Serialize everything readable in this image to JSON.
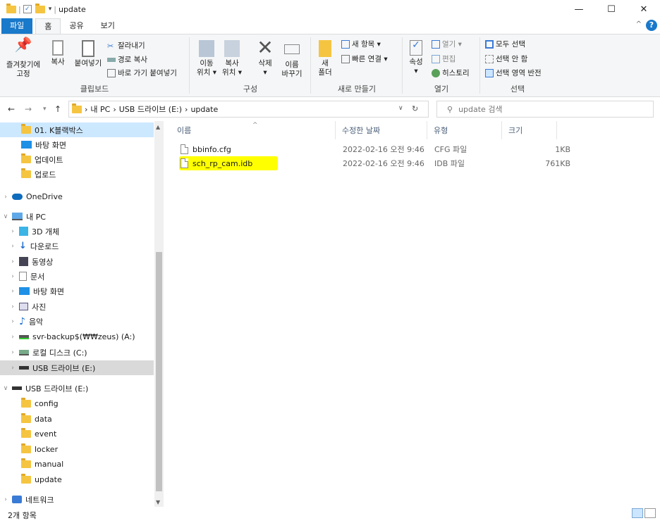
{
  "window": {
    "title": "update",
    "minimize": "—",
    "maximize": "☐",
    "close": "✕"
  },
  "tabs": {
    "file": "파일",
    "home": "홈",
    "share": "공유",
    "view": "보기"
  },
  "ribbon": {
    "clipboard": {
      "label": "클립보드",
      "pin": "즐겨찾기에\n고정",
      "copy": "복사",
      "paste": "붙여넣기",
      "cut": "잘라내기",
      "copy_path": "경로 복사",
      "paste_shortcut": "바로 가기 붙여넣기"
    },
    "organize": {
      "label": "구성",
      "move_to": "이동\n위치 ▾",
      "copy_to": "복사\n위치 ▾",
      "delete": "삭제\n▾",
      "rename": "이름\n바꾸기"
    },
    "new": {
      "label": "새로 만들기",
      "new_folder": "새\n폴더",
      "new_item": "새 항목 ▾",
      "easy_access": "빠른 연결 ▾"
    },
    "open": {
      "label": "열기",
      "properties": "속성\n▾",
      "open": "열기 ▾",
      "edit": "편집",
      "history": "히스토리"
    },
    "select": {
      "label": "선택",
      "select_all": "모두 선택",
      "select_none": "선택 안 함",
      "invert": "선택 영역 반전"
    }
  },
  "address": {
    "crumbs": [
      "내 PC",
      "USB 드라이브 (E:)",
      "update"
    ],
    "search_placeholder": "update 검색"
  },
  "nav": {
    "items": [
      {
        "label": "01. K블랙박스",
        "icon": "folder-icon"
      },
      {
        "label": "바탕 화면",
        "icon": "desktop-icon"
      },
      {
        "label": "업데이트",
        "icon": "folder-icon"
      },
      {
        "label": "업로드",
        "icon": "folder-icon"
      },
      {
        "label": "OneDrive",
        "icon": "cloud-icon"
      },
      {
        "label": "내 PC",
        "icon": "pc-icon"
      },
      {
        "label": "3D 개체",
        "icon": "cube-icon"
      },
      {
        "label": "다운로드",
        "icon": "download-icon"
      },
      {
        "label": "동영상",
        "icon": "video-icon"
      },
      {
        "label": "문서",
        "icon": "document-icon"
      },
      {
        "label": "바탕 화면",
        "icon": "desktop-icon"
      },
      {
        "label": "사진",
        "icon": "picture-icon"
      },
      {
        "label": "음악",
        "icon": "music-icon"
      },
      {
        "label": "svr-backup$(₩₩zeus) (A:)",
        "icon": "network-drive-icon"
      },
      {
        "label": "로컬 디스크 (C:)",
        "icon": "disk-icon"
      },
      {
        "label": "USB 드라이브 (E:)",
        "icon": "usb-icon"
      },
      {
        "label": "USB 드라이브 (E:)",
        "icon": "usb-icon"
      },
      {
        "label": "config",
        "icon": "folder-icon"
      },
      {
        "label": "data",
        "icon": "folder-icon"
      },
      {
        "label": "event",
        "icon": "folder-icon"
      },
      {
        "label": "locker",
        "icon": "folder-icon"
      },
      {
        "label": "manual",
        "icon": "folder-icon"
      },
      {
        "label": "update",
        "icon": "folder-icon"
      },
      {
        "label": "네트워크",
        "icon": "network-icon"
      }
    ]
  },
  "columns": {
    "name": "이름",
    "date": "수정한 날짜",
    "type": "유형",
    "size": "크기"
  },
  "files": [
    {
      "name": "bbinfo.cfg",
      "date": "2022-02-16 오전 9:46",
      "type": "CFG 파일",
      "size": "1KB"
    },
    {
      "name": "sch_rp_cam.idb",
      "date": "2022-02-16 오전 9:46",
      "type": "IDB 파일",
      "size": "761KB"
    }
  ],
  "status": {
    "count": "2개 항목"
  },
  "colors": {
    "accent": "#1979ca",
    "selection": "#cce8ff",
    "highlight": "#ffff00",
    "folder": "#f5c542"
  }
}
